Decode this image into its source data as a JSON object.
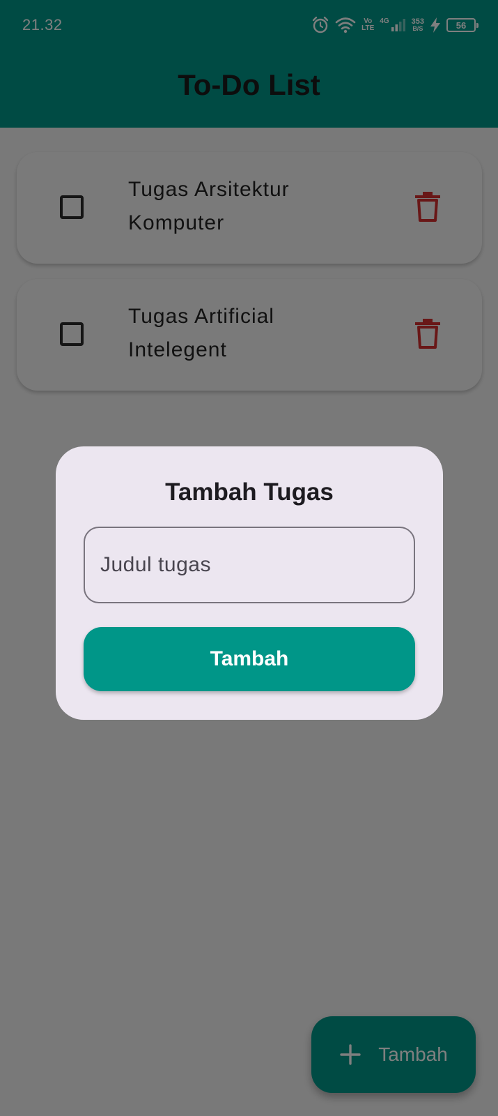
{
  "colors": {
    "accent": "#009688",
    "delete_icon": "#d32f2f",
    "dialog_surface": "#ece6f0",
    "scrim": "rgba(0,0,0,0.5)"
  },
  "status_bar": {
    "time": "21.32",
    "network_top": "Vo",
    "network_bottom": "LTE",
    "network_type": "4G",
    "speed_value": "353",
    "speed_unit": "B/S",
    "battery_level": "56",
    "icons": [
      "alarm-icon",
      "wifi-icon",
      "signal-icon",
      "charging-icon",
      "battery-icon"
    ]
  },
  "app_bar": {
    "title": "To-Do List"
  },
  "tasks": [
    {
      "title": "Tugas Arsitektur Komputer",
      "checked": false
    },
    {
      "title": "Tugas Artificial Intelegent",
      "checked": false
    }
  ],
  "fab": {
    "label": "Tambah",
    "icon": "plus-icon"
  },
  "dialog": {
    "title": "Tambah Tugas",
    "input_value": "",
    "input_placeholder": "Judul tugas",
    "button_label": "Tambah"
  }
}
